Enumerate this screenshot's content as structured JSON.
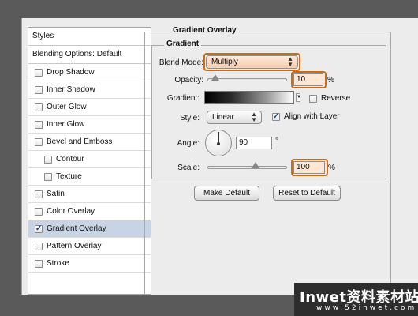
{
  "styles_panel": {
    "header": "Styles",
    "blending_options": "Blending Options: Default",
    "items": [
      {
        "label": "Drop Shadow",
        "checked": false,
        "sub": false
      },
      {
        "label": "Inner Shadow",
        "checked": false,
        "sub": false
      },
      {
        "label": "Outer Glow",
        "checked": false,
        "sub": false
      },
      {
        "label": "Inner Glow",
        "checked": false,
        "sub": false
      },
      {
        "label": "Bevel and Emboss",
        "checked": false,
        "sub": false
      },
      {
        "label": "Contour",
        "checked": false,
        "sub": true
      },
      {
        "label": "Texture",
        "checked": false,
        "sub": true
      },
      {
        "label": "Satin",
        "checked": false,
        "sub": false
      },
      {
        "label": "Color Overlay",
        "checked": false,
        "sub": false
      },
      {
        "label": "Gradient Overlay",
        "checked": true,
        "sub": false,
        "selected": true
      },
      {
        "label": "Pattern Overlay",
        "checked": false,
        "sub": false
      },
      {
        "label": "Stroke",
        "checked": false,
        "sub": false
      }
    ]
  },
  "gradient_overlay": {
    "title": "Gradient Overlay",
    "group_title": "Gradient",
    "blend_mode": {
      "label": "Blend Mode:",
      "value": "Multiply"
    },
    "opacity": {
      "label": "Opacity:",
      "value": "10",
      "unit": "%",
      "slider_fraction": 0.1
    },
    "gradient": {
      "label": "Gradient:",
      "reverse_label": "Reverse",
      "reverse_checked": false
    },
    "style": {
      "label": "Style:",
      "value": "Linear",
      "align_label": "Align with Layer",
      "align_checked": true
    },
    "angle": {
      "label": "Angle:",
      "value": "90",
      "unit": "°"
    },
    "scale": {
      "label": "Scale:",
      "value": "100",
      "unit": "%",
      "slider_fraction": 0.6
    },
    "buttons": {
      "make_default": "Make Default",
      "reset_default": "Reset to Default"
    }
  },
  "colors": {
    "highlight": "#d06a10",
    "selected_row": "#c8d3e4"
  },
  "watermark": {
    "main": "Inwet资料素材站",
    "sub": "www.52inwet.com"
  }
}
